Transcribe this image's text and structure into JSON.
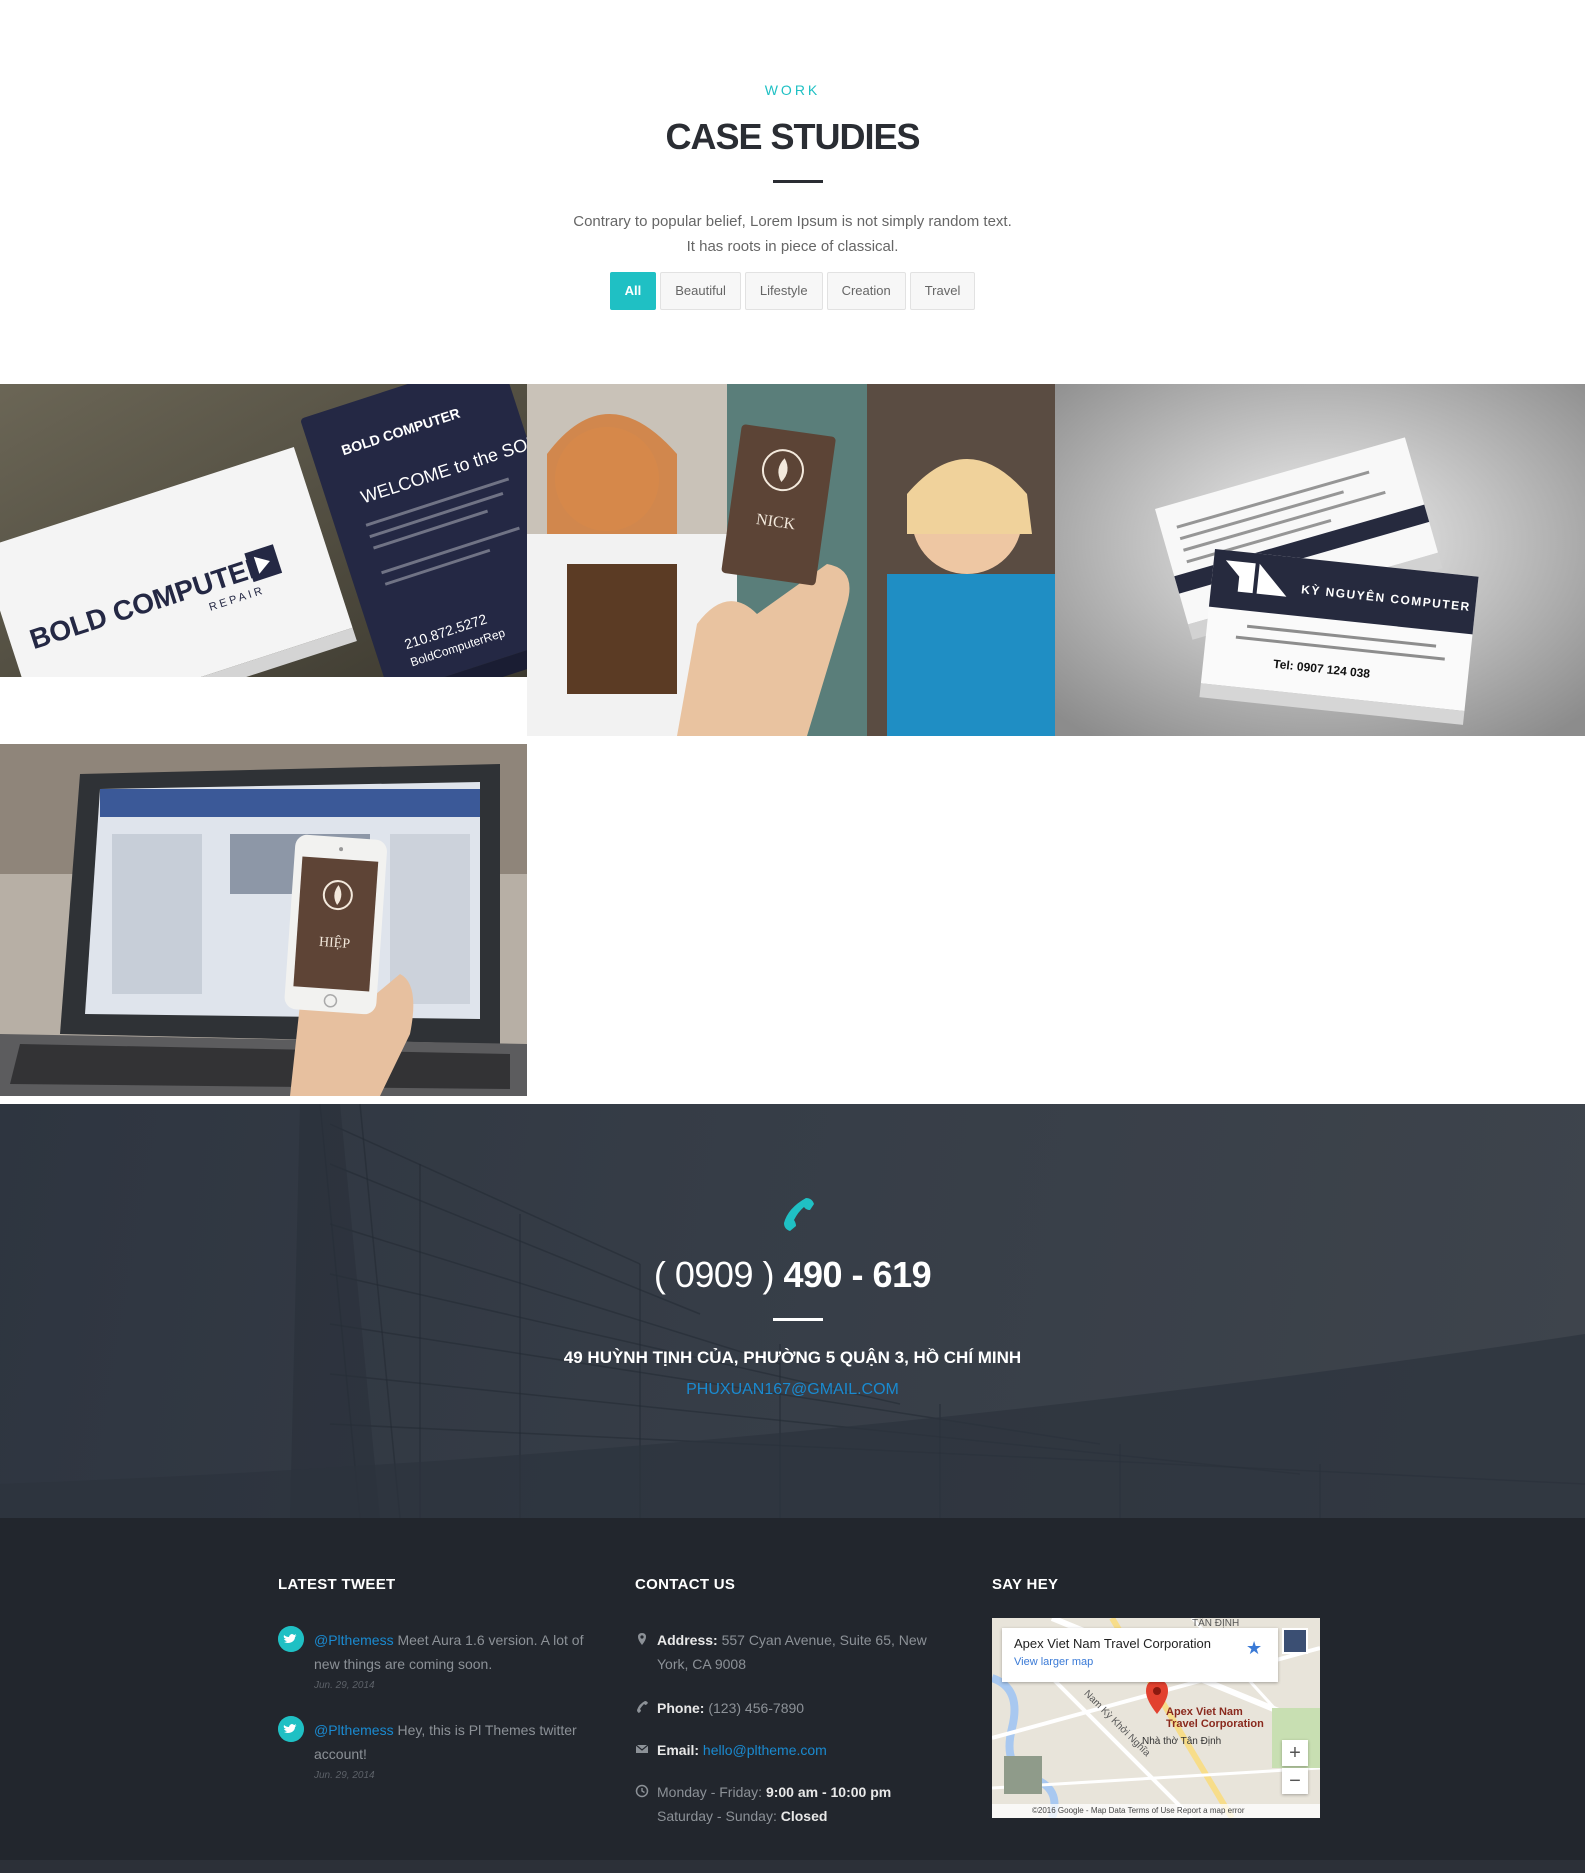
{
  "work": {
    "eyebrow": "WORK",
    "title": "CASE STUDIES",
    "lead_line1": "Contrary to popular belief, Lorem Ipsum is not simply random text.",
    "lead_line2": "It has roots in piece of classical.",
    "filters": [
      "All",
      "Beautiful",
      "Lifestyle",
      "Creation",
      "Travel"
    ],
    "active_filter": "All",
    "portfolio": [
      {
        "card_brand": "BOLD COMPUTER",
        "card_sub": "REPAIR",
        "card_back_title": "WELCOME to the SOLUTION",
        "card_phone": "210.872.5272",
        "card_site": "BoldComputerRep"
      },
      {
        "card_name": "NICK"
      },
      {
        "card_brand": "KỲ NGUYÊN COMPUTER",
        "card_phone": "Tel: 0907 124 038"
      },
      {
        "card_name": "HIỆP"
      }
    ]
  },
  "contact_band": {
    "phone_area": "( 0909 )",
    "phone_main": "490 - 619",
    "address": "49 HUỲNH TỊNH CỦA, PHƯỜNG 5 QUẬN 3, HỒ CHÍ MINH",
    "email": "PHUXUAN167@GMAIL.COM",
    "icon": "phone-icon"
  },
  "footer": {
    "latest_tweet": {
      "heading": "LATEST TWEET",
      "tweets": [
        {
          "handle": "@Plthemess",
          "text": " Meet Aura 1.6 version. A lot of new things are coming soon.",
          "date": "Jun. 29, 2014"
        },
        {
          "handle": "@Plthemess",
          "text": " Hey, this is Pl Themes twitter account!",
          "date": "Jun. 29, 2014"
        }
      ]
    },
    "contact_us": {
      "heading": "CONTACT US",
      "address_label": "Address:",
      "address": " 557 Cyan Avenue, Suite 65, New York, CA 9008",
      "phone_label": "Phone:",
      "phone": " (123) 456-7890",
      "email_label": "Email:",
      "email": "hello@pltheme.com",
      "hours_weekday_label": "Monday - Friday: ",
      "hours_weekday": "9:00 am - 10:00 pm",
      "hours_weekend_label": "Saturday - Sunday: ",
      "hours_weekend": "Closed"
    },
    "say_hey": {
      "heading": "SAY HEY",
      "map_place": "Apex Viet Nam Travel Corporation",
      "map_link": "View larger map",
      "map_pin_label_1": "Apex Viet Nam",
      "map_pin_label_2": "Travel Corporation",
      "map_church": "Nhà thờ Tân Định",
      "map_district": "TÂN ĐỊNH",
      "map_street": "Nam Kỳ Khởi Nghĩa",
      "map_footer": "©2016 Google - Map Data    Terms of Use    Report a map error",
      "zoom_in": "+",
      "zoom_out": "−"
    }
  },
  "colors": {
    "accent": "#1fc0c4",
    "link": "#1a8ad0",
    "dark": "#22262d",
    "heading": "#2a2d33"
  }
}
